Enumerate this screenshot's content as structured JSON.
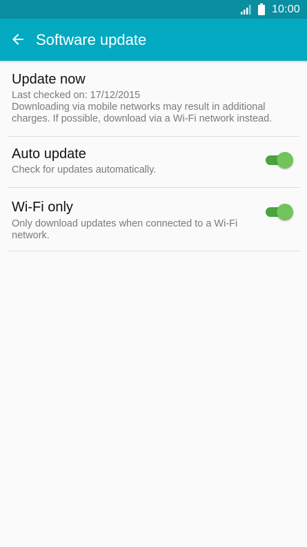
{
  "status_bar": {
    "time": "10:00",
    "icons": [
      "signal-icon",
      "battery-icon"
    ]
  },
  "app_bar": {
    "title": "Software update",
    "back_icon": "arrow-left-icon"
  },
  "settings": {
    "update_now": {
      "title": "Update now",
      "summary_line1": "Last checked on: 17/12/2015",
      "summary_line2": "Downloading via mobile networks may result in additional charges. If possible, download via a Wi-Fi network instead."
    },
    "auto_update": {
      "title": "Auto update",
      "summary": "Check for updates automatically.",
      "enabled": true
    },
    "wifi_only": {
      "title": "Wi-Fi only",
      "summary": "Only download updates when connected to a Wi-Fi network.",
      "enabled": true
    }
  },
  "colors": {
    "status_bar": "#0a8ea1",
    "app_bar": "#03a9c1",
    "toggle_track": "#4aa33e",
    "toggle_thumb": "#72c35a",
    "background": "#fafafa"
  }
}
